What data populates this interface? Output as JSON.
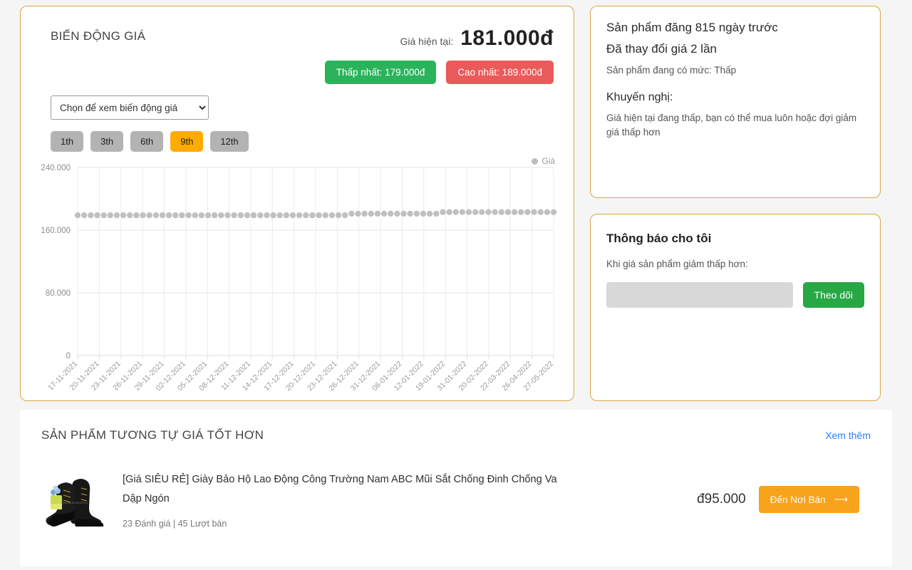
{
  "chart_card": {
    "title": "BIẾN ĐỘNG GIÁ",
    "current_price_label": "Giá hiện tại:",
    "current_price_value": "181.000đ",
    "lowest_badge": "Thấp nhất: 179.000đ",
    "highest_badge": "Cao nhất: 189.000đ",
    "lowest_color": "#2bb35c",
    "highest_color": "#ea5a5a",
    "select_value": "Chọn để xem biến động giá",
    "select_options": [
      "Chọn để xem biến động giá"
    ],
    "ranges": [
      {
        "label": "1th",
        "active": false
      },
      {
        "label": "3th",
        "active": false
      },
      {
        "label": "6th",
        "active": false
      },
      {
        "label": "9th",
        "active": true
      },
      {
        "label": "12th",
        "active": false
      }
    ],
    "active_range_color": "#ffab00"
  },
  "chart_data": {
    "type": "scatter",
    "title": "",
    "xlabel": "",
    "ylabel": "",
    "ylim": [
      0,
      240000
    ],
    "yticks": [
      0,
      80000,
      160000,
      240000
    ],
    "ytick_labels": [
      "0",
      "80.000",
      "160.000",
      "240.000"
    ],
    "grid": true,
    "legend": [
      "Giá"
    ],
    "legend_position": "top-right",
    "series_color": "#bdbdbd",
    "categories": [
      "17-11-2021",
      "20-11-2021",
      "23-11-2021",
      "26-11-2021",
      "29-11-2021",
      "02-12-2021",
      "05-12-2021",
      "08-12-2021",
      "11-12-2021",
      "14-12-2021",
      "17-12-2021",
      "20-12-2021",
      "23-12-2021",
      "26-12-2021",
      "31-12-2021",
      "06-01-2022",
      "12-01-2022",
      "19-01-2022",
      "31-01-2022",
      "20-02-2022",
      "22-03-2022",
      "26-04-2022",
      "27-05-2022"
    ],
    "series": [
      {
        "name": "Giá",
        "values": [
          179000,
          179000,
          179000,
          179000,
          179000,
          179000,
          179000,
          179000,
          179000,
          179000,
          179000,
          179000,
          179000,
          179000,
          179000,
          179000,
          179000,
          179000,
          179000,
          179000,
          179000,
          179000,
          179000,
          179000,
          179000,
          179000,
          179000,
          179000,
          179000,
          179000,
          179000,
          179000,
          179000,
          179000,
          179000,
          179000,
          179000,
          179000,
          179000,
          179000,
          179000,
          179000,
          181000,
          181000,
          181000,
          181000,
          181000,
          181000,
          181000,
          181000,
          181000,
          181000,
          181000,
          181000,
          181000,
          181000,
          183000,
          183000,
          183000,
          183000,
          183000,
          183000,
          183000,
          183000,
          183000,
          183000,
          183000,
          183000,
          183000,
          183000,
          183000,
          183000,
          183000,
          183000
        ]
      }
    ]
  },
  "info_card": {
    "posted": "Sản phẩm đăng 815 ngày trước",
    "changes": "Đã thay đổi giá 2 lần",
    "level": "Sản phẩm đang có mức: Thấp",
    "recommend_title": "Khuyến nghị:",
    "recommend_body": "Giá hiện tại đang thấp, bạn có thể mua luôn hoặc đợi giảm giá thấp hơn"
  },
  "notify_card": {
    "title": "Thông báo cho tôi",
    "subtitle": "Khi giá sản phẩm giảm thấp hơn:",
    "input_value": "",
    "input_placeholder": "",
    "button_label": "Theo dõi",
    "button_color": "#28a745"
  },
  "similar": {
    "title": "SẢN PHẨM TƯƠNG TỰ GIÁ TỐT HƠN",
    "see_more": "Xem thêm",
    "see_more_color": "#2b7fff",
    "products": [
      {
        "name": "[Giá SIÊU RẺ] Giày Bảo Hộ Lao Động Công Trường Nam ABC Mũi Sắt Chống Đinh Chống Va Dập Ngón",
        "meta": "23 Đánh giá | 45 Lượt bán",
        "price": "đ95.000",
        "cta": "Đến Nơi Bán",
        "cta_color": "#f7a31b",
        "thumb_alt": "black-safety-boots"
      }
    ]
  }
}
